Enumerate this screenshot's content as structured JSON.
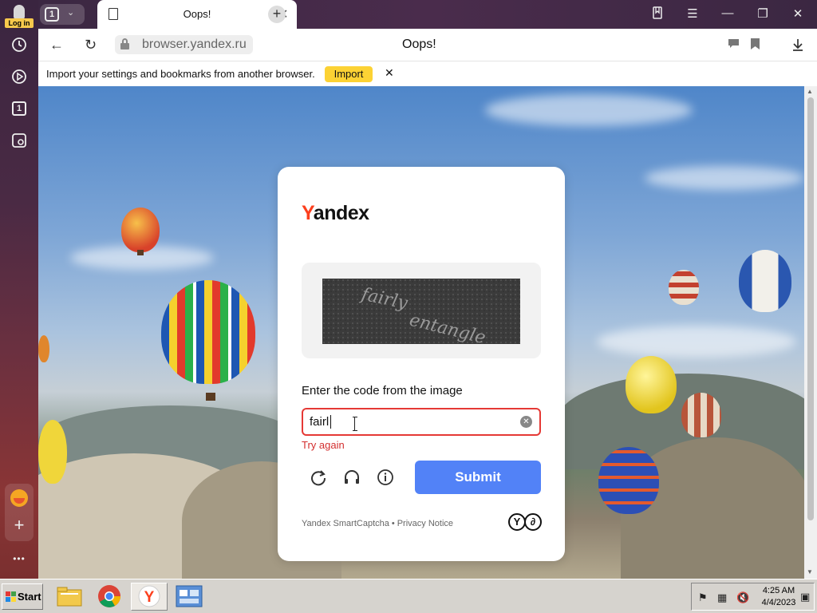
{
  "sidebar": {
    "login_label": "Log in",
    "icons": [
      "history-icon",
      "play-icon",
      "tab-counter-icon",
      "screenshot-icon",
      "alice-icon",
      "add-icon",
      "more-icon"
    ],
    "tab_count": "1",
    "more_glyph": "•••"
  },
  "tabs": {
    "tab_count": "1",
    "active_title": "Oops!"
  },
  "addressbar": {
    "url": "browser.yandex.ru",
    "page_title": "Oops!"
  },
  "infobar": {
    "message": "Import your settings and bookmarks from another browser.",
    "import_label": "Import"
  },
  "captcha": {
    "logo_first": "Y",
    "logo_rest": "andex",
    "image_text_1": "fairly",
    "image_text_2": "entangle",
    "prompt": "Enter the code from the image",
    "input_value": "fairl",
    "error": "Try again",
    "submit_label": "Submit",
    "footer_left": "Yandex SmartCaptcha",
    "footer_sep": "•",
    "footer_right": "Privacy Notice",
    "mark_1": "Y",
    "mark_2": "∂"
  },
  "taskbar": {
    "start_label": "Start",
    "time": "4:25 AM",
    "date": "4/4/2023"
  },
  "colors": {
    "accent_submit": "#5282f7",
    "import_button": "#fcd234",
    "error": "#d32f2f",
    "logo_y": "#fc3f1d"
  }
}
